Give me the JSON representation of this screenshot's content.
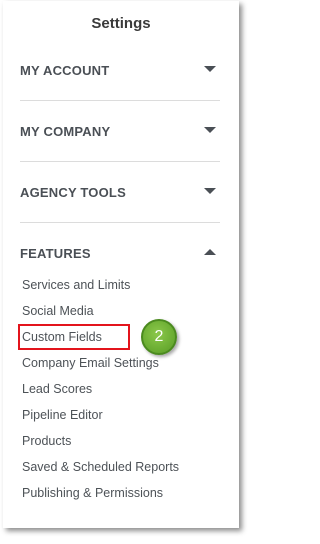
{
  "panel": {
    "title": "Settings"
  },
  "sections": {
    "my_account": {
      "label": "MY ACCOUNT",
      "caret": "chevron-down-icon"
    },
    "my_company": {
      "label": "MY COMPANY",
      "caret": "chevron-down-icon"
    },
    "agency_tools": {
      "label": "AGENCY TOOLS",
      "caret": "chevron-down-icon"
    },
    "features": {
      "label": "FEATURES",
      "caret": "chevron-up-icon",
      "items": [
        "Services and Limits",
        "Social Media",
        "Custom Fields",
        "Company Email Settings",
        "Lead Scores",
        "Pipeline Editor",
        "Products",
        "Saved & Scheduled Reports",
        "Publishing & Permissions"
      ]
    }
  },
  "annotation": {
    "step_number": "2",
    "highlight_color": "#e3141c",
    "badge_color": "#6cae33"
  }
}
